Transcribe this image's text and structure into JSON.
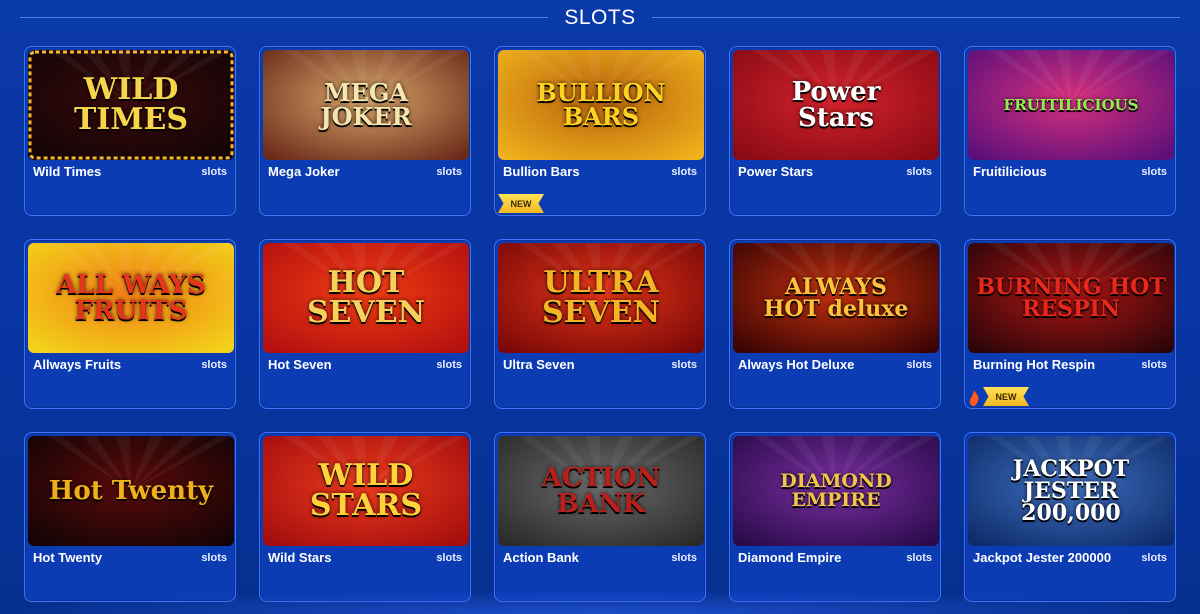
{
  "section": {
    "title": "SLOTS"
  },
  "games": [
    {
      "name": "Wild Times",
      "category": "slots",
      "logo": "WILD\nTIMES",
      "badge": null,
      "bg1": "#120406",
      "bg2": "#3a0a0a",
      "logo_color": "#f6d54a",
      "border": "#f3b82c"
    },
    {
      "name": "Mega Joker",
      "category": "slots",
      "logo": "MEGA\nJOKER",
      "badge": null,
      "bg1": "#6a2a1a",
      "bg2": "#d8a76a",
      "logo_color": "#f5e6b0",
      "border": null
    },
    {
      "name": "Bullion Bars",
      "category": "slots",
      "logo": "BULLION\nBARS",
      "badge": "NEW",
      "bg1": "#f0b21c",
      "bg2": "#b8620c",
      "logo_color": "#ffd21f",
      "border": null
    },
    {
      "name": "Power Stars",
      "category": "slots",
      "logo": "Power\nStars",
      "badge": null,
      "bg1": "#8a0a14",
      "bg2": "#d2232c",
      "logo_color": "#ffffff",
      "border": null
    },
    {
      "name": "Fruitilicious",
      "category": "slots",
      "logo": "FRUITILICIOUS",
      "badge": null,
      "bg1": "#5a0f7a",
      "bg2": "#d7307e",
      "logo_color": "#8ef04a",
      "border": null
    },
    {
      "name": "Allways Fruits",
      "category": "slots",
      "logo": "ALL WAYS\nFRUITS",
      "badge": null,
      "bg1": "#f3d41a",
      "bg2": "#f07d14",
      "logo_color": "#e8341c",
      "border": null
    },
    {
      "name": "Hot Seven",
      "category": "slots",
      "logo": "HOT\nSEVEN",
      "badge": null,
      "bg1": "#b30f0f",
      "bg2": "#ef3c12",
      "logo_color": "#f7d25a",
      "border": null
    },
    {
      "name": "Ultra Seven",
      "category": "slots",
      "logo": "ULTRA\nSEVEN",
      "badge": null,
      "bg1": "#7a0808",
      "bg2": "#e03416",
      "logo_color": "#f5b423",
      "border": null
    },
    {
      "name": "Always Hot Deluxe",
      "category": "slots",
      "logo": "ALWAYS\nHOT deluxe",
      "badge": null,
      "bg1": "#3a0404",
      "bg2": "#c2300e",
      "logo_color": "#ffc23a",
      "border": null
    },
    {
      "name": "Burning Hot Respin",
      "category": "slots",
      "logo": "BURNING HOT\nRESPIN",
      "badge": "NEW",
      "bg1": "#2a0508",
      "bg2": "#b01616",
      "logo_color": "#e8281a",
      "border": null
    },
    {
      "name": "Hot Twenty",
      "category": "slots",
      "logo": "Hot Twenty",
      "badge": null,
      "bg1": "#140405",
      "bg2": "#5a0a0a",
      "logo_color": "#f0b01c",
      "border": null
    },
    {
      "name": "Wild Stars",
      "category": "slots",
      "logo": "WILD\nSTARS",
      "badge": null,
      "bg1": "#a30d0d",
      "bg2": "#ea3a1c",
      "logo_color": "#ffd23a",
      "border": null
    },
    {
      "name": "Action Bank",
      "category": "slots",
      "logo": "ACTION\nBANK",
      "badge": null,
      "bg1": "#2a2a2a",
      "bg2": "#6a6a6a",
      "logo_color": "#b8201c",
      "border": null
    },
    {
      "name": "Diamond Empire",
      "category": "slots",
      "logo": "DIAMOND\nEMPIRE",
      "badge": null,
      "bg1": "#2a0a4a",
      "bg2": "#7a2fa0",
      "logo_color": "#f2c44a",
      "border": null
    },
    {
      "name": "Jackpot Jester 200000",
      "category": "slots",
      "logo": "JACKPOT\nJESTER\n200,000",
      "badge": null,
      "bg1": "#0d2b6a",
      "bg2": "#4070c0",
      "logo_color": "#ffffff",
      "border": null
    }
  ],
  "colors": {
    "background": "#0a3aa8",
    "card": "#0b3cb4",
    "card_border": "#3f74ff",
    "badge": "#f2c12a"
  }
}
